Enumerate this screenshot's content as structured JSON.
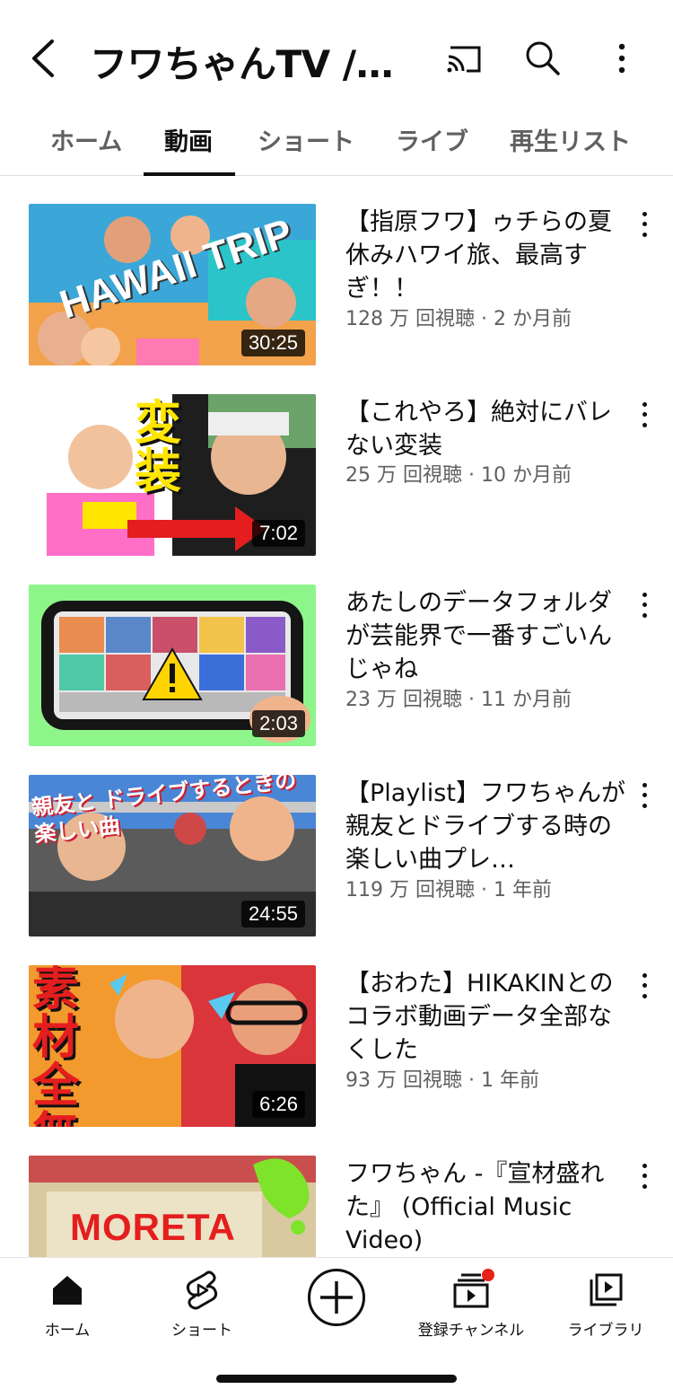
{
  "header": {
    "title": "フワちゃんTV /F...",
    "back_icon": "back-chevron-icon",
    "cast_icon": "cast-icon",
    "search_icon": "search-icon",
    "more_icon": "more-vert-icon"
  },
  "tabs": [
    {
      "label": "ホーム"
    },
    {
      "label": "動画",
      "active": true
    },
    {
      "label": "ショート"
    },
    {
      "label": "ライブ"
    },
    {
      "label": "再生リスト"
    }
  ],
  "videos": [
    {
      "title": "【指原フワ】ゥチらの夏休みハワイ旅、最高すぎ！！",
      "meta": "128 万 回視聴 · 2 か月前",
      "duration": "30:25",
      "thumb_text": "HAWAII TRIP"
    },
    {
      "title": "【これやろ】絶対にバレない変装",
      "meta": "25 万 回視聴 · 10 か月前",
      "duration": "7:02",
      "thumb_text": "変装"
    },
    {
      "title": "あたしのデータフォルダが芸能界で一番すごいんじゃね",
      "meta": "23 万 回視聴 · 11 か月前",
      "duration": "2:03"
    },
    {
      "title": "【Playlist】フワちゃんが親友とドライブする時の楽しい曲プレ…",
      "meta": "119 万 回視聴 · 1 年前",
      "duration": "24:55",
      "thumb_text": "親友と ドライブするときの 楽しい曲"
    },
    {
      "title": "【おわた】HIKAKINとのコラボ動画データ全部なくした",
      "meta": "93 万 回視聴 · 1 年前",
      "duration": "6:26",
      "thumb_text": "素材 全無く!"
    },
    {
      "title": "フワちゃん -『宣材盛れた』 (Official Music Video)",
      "meta": "",
      "duration": "",
      "thumb_text": "MORETA"
    }
  ],
  "bottom_nav": [
    {
      "label": "ホーム",
      "icon": "home-icon"
    },
    {
      "label": "ショート",
      "icon": "shorts-icon"
    },
    {
      "label": "",
      "icon": "create-plus-icon"
    },
    {
      "label": "登録チャンネル",
      "icon": "subscriptions-icon"
    },
    {
      "label": "ライブラリ",
      "icon": "library-icon"
    }
  ],
  "colors": {
    "text": "#0f0f0f",
    "secondary": "#606060",
    "notification": "#e62117"
  }
}
